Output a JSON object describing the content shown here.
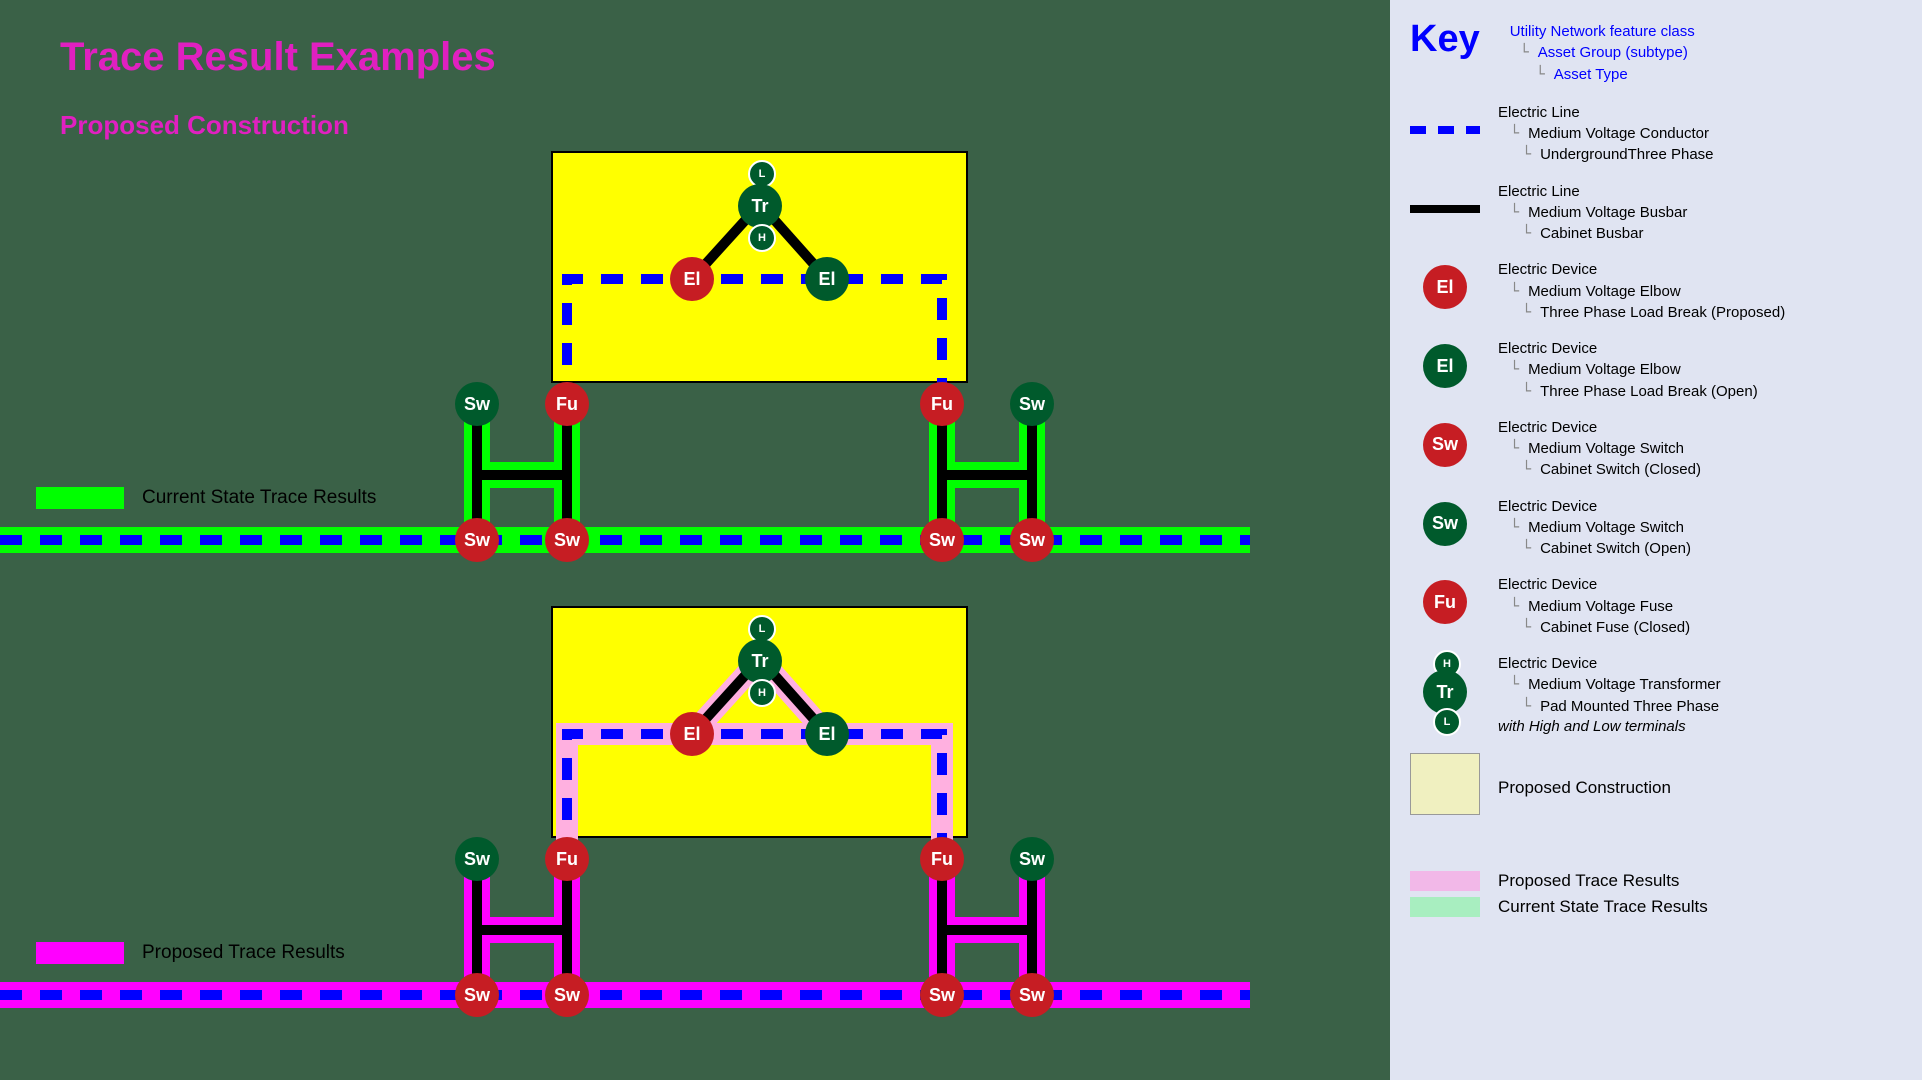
{
  "title": "Trace Result Examples",
  "subtitle": "Proposed Construction",
  "labels": {
    "current_state": "Current State Trace Results",
    "proposed": "Proposed Trace Results"
  },
  "nodes": {
    "sw": "Sw",
    "fu": "Fu",
    "el": "El",
    "tr": "Tr",
    "l": "L",
    "h": "H"
  },
  "key": {
    "title": "Key",
    "hierarchy": {
      "l1": "Utility Network feature class",
      "l2": "Asset Group (subtype)",
      "l3": "Asset Type"
    },
    "items": [
      {
        "l1": "Electric Line",
        "l2": "Medium Voltage Conductor",
        "l3": "UndergroundThree Phase"
      },
      {
        "l1": "Electric Line",
        "l2": "Medium Voltage Busbar",
        "l3": "Cabinet Busbar"
      },
      {
        "l1": "Electric Device",
        "l2": "Medium Voltage Elbow",
        "l3": "Three Phase Load Break (Proposed)"
      },
      {
        "l1": "Electric Device",
        "l2": "Medium Voltage Elbow",
        "l3": "Three Phase Load Break (Open)"
      },
      {
        "l1": "Electric Device",
        "l2": "Medium Voltage Switch",
        "l3": "Cabinet Switch (Closed)"
      },
      {
        "l1": "Electric Device",
        "l2": "Medium Voltage Switch",
        "l3": "Cabinet Switch (Open)"
      },
      {
        "l1": "Electric Device",
        "l2": "Medium Voltage Fuse",
        "l3": "Cabinet Fuse (Closed)"
      },
      {
        "l1": "Electric Device",
        "l2": "Medium Voltage Transformer",
        "l3": "Pad Mounted Three Phase",
        "note": "with High and Low terminals"
      }
    ],
    "proposed_box": "Proposed Construction",
    "proposed_trace": "Proposed Trace Results",
    "current_trace": "Current State Trace Results"
  }
}
